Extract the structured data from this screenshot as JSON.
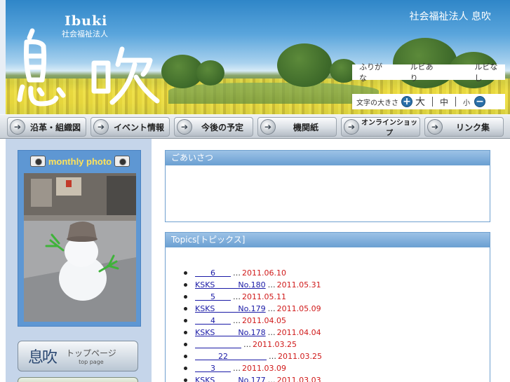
{
  "header": {
    "logo_en": "Ibuki",
    "logo_jp_small": "社会福祉法人",
    "org_name": "社会福祉法人 息吹",
    "ruby": {
      "label": "ふりがな",
      "on": "ルビあり",
      "off": "ルビなし"
    },
    "font_size": {
      "label": "文字の大きさ",
      "large": "大",
      "medium": "中",
      "small": "小",
      "plus_icon": "plus-icon",
      "minus_icon": "minus-icon"
    }
  },
  "nav": {
    "items": [
      {
        "label": "沿革・組織図"
      },
      {
        "label": "イベント情報"
      },
      {
        "label": "今後の予定"
      },
      {
        "label": "機関紙"
      },
      {
        "label": "オンラインショップ"
      },
      {
        "label": "リンク集"
      }
    ]
  },
  "sidebar": {
    "photo_title": "monthly photo",
    "top_button": {
      "glyph": "息吹",
      "label": "トップページ",
      "sub": "top page"
    }
  },
  "main": {
    "greeting": {
      "title": "ごあいさつ"
    },
    "topics": {
      "title": "Topics[トピックス]",
      "items": [
        {
          "link": "　　6　　",
          "dots": "…",
          "date": "2011.06.10"
        },
        {
          "link": "KSKS　　　No.180",
          "dots": "…",
          "date": "2011.05.31"
        },
        {
          "link": "　　5　　",
          "dots": "…",
          "date": "2011.05.11"
        },
        {
          "link": "KSKS　　　No.179",
          "dots": "…",
          "date": "2011.05.09"
        },
        {
          "link": "　　4　　",
          "dots": "…",
          "date": "2011.04.05"
        },
        {
          "link": "KSKS　　　No.178",
          "dots": "…",
          "date": "2011.04.04"
        },
        {
          "link": "　　　　　　",
          "dots": "…",
          "date": "2011.03.25"
        },
        {
          "link": "　　　22　　　　　",
          "dots": "…",
          "date": "2011.03.25"
        },
        {
          "link": "　　3　　",
          "dots": "…",
          "date": "2011.03.09"
        },
        {
          "link": "KSKS　　　No.177",
          "dots": "…",
          "date": "2011.03.03"
        }
      ]
    }
  },
  "colors": {
    "accent": "#6a9fd2",
    "date": "#d01a1a",
    "link": "#1a1aa6",
    "sidebar_bg": "#c5d5ea"
  }
}
